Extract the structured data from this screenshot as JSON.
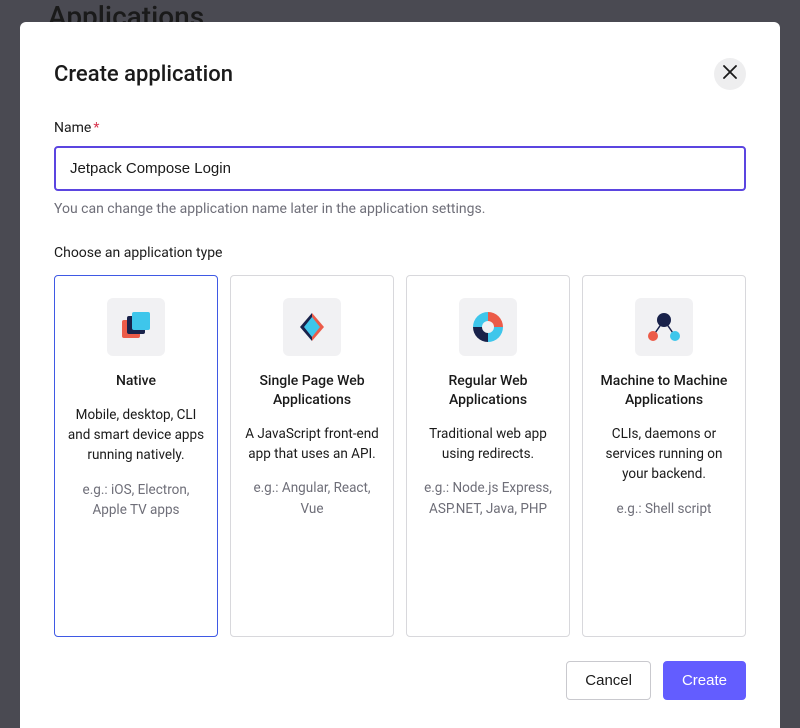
{
  "backdrop": {
    "title": "Applications"
  },
  "modal": {
    "title": "Create application",
    "name_label": "Name",
    "name_value": "Jetpack Compose Login",
    "name_helper": "You can change the application name later in the application settings.",
    "type_label": "Choose an application type",
    "types": [
      {
        "title": "Native",
        "desc": "Mobile, desktop, CLI and smart device apps running natively.",
        "example": "e.g.: iOS, Electron, Apple TV apps",
        "selected": true
      },
      {
        "title": "Single Page Web Applications",
        "desc": "A JavaScript front-end app that uses an API.",
        "example": "e.g.: Angular, React, Vue",
        "selected": false
      },
      {
        "title": "Regular Web Applications",
        "desc": "Traditional web app using redirects.",
        "example": "e.g.: Node.js Express, ASP.NET, Java, PHP",
        "selected": false
      },
      {
        "title": "Machine to Machine Applications",
        "desc": "CLIs, daemons or services running on your backend.",
        "example": "e.g.: Shell script",
        "selected": false
      }
    ],
    "cancel_label": "Cancel",
    "create_label": "Create"
  }
}
